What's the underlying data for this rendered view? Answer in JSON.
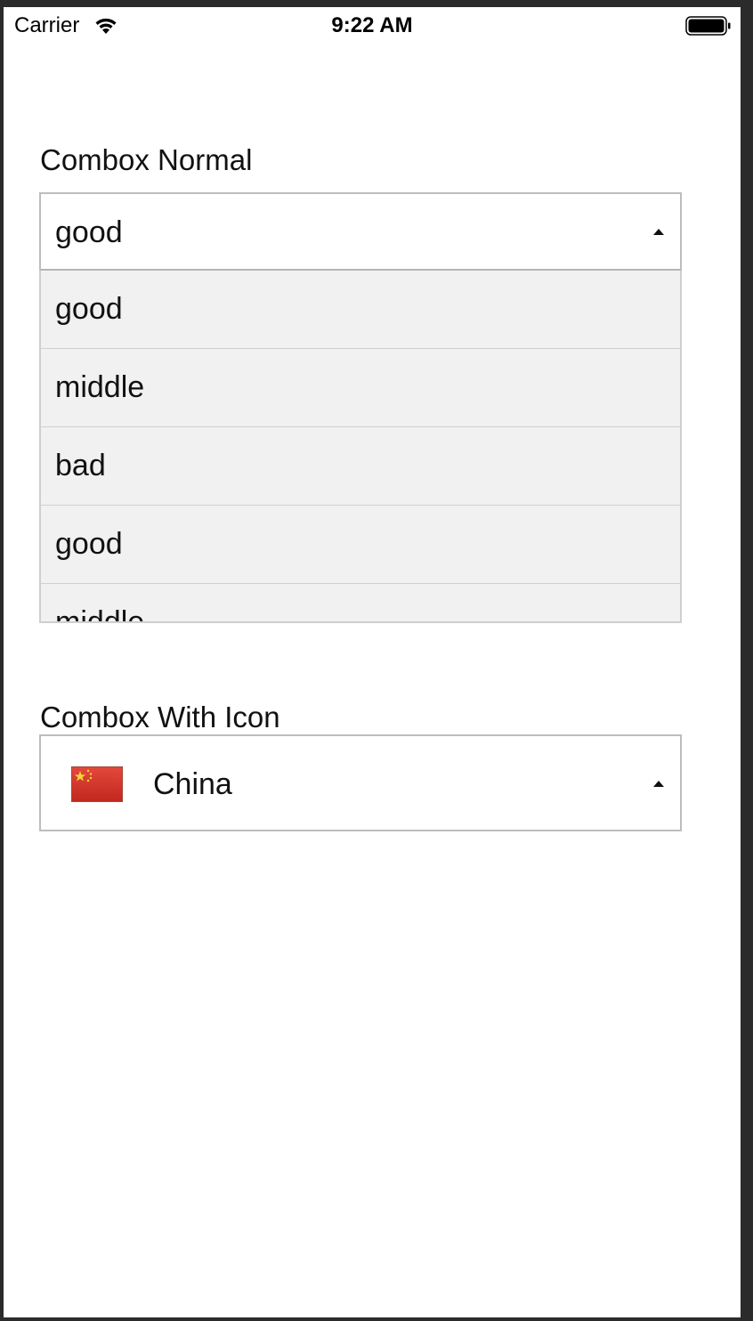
{
  "status_bar": {
    "carrier": "Carrier",
    "time": "9:22 AM"
  },
  "combo_normal": {
    "title": "Combox Normal",
    "value": "good",
    "options": [
      "good",
      "middle",
      "bad",
      "good",
      "middle"
    ],
    "expanded": true
  },
  "combo_icon": {
    "title": "Combox With Icon",
    "value": "China",
    "flag_icon": "china-flag-icon",
    "expanded": false
  },
  "colors": {
    "dropdown_bg": "#f1f1f1",
    "border": "#bdbdbd",
    "flag_red": "#d8382d",
    "flag_star": "#f5d53b"
  }
}
